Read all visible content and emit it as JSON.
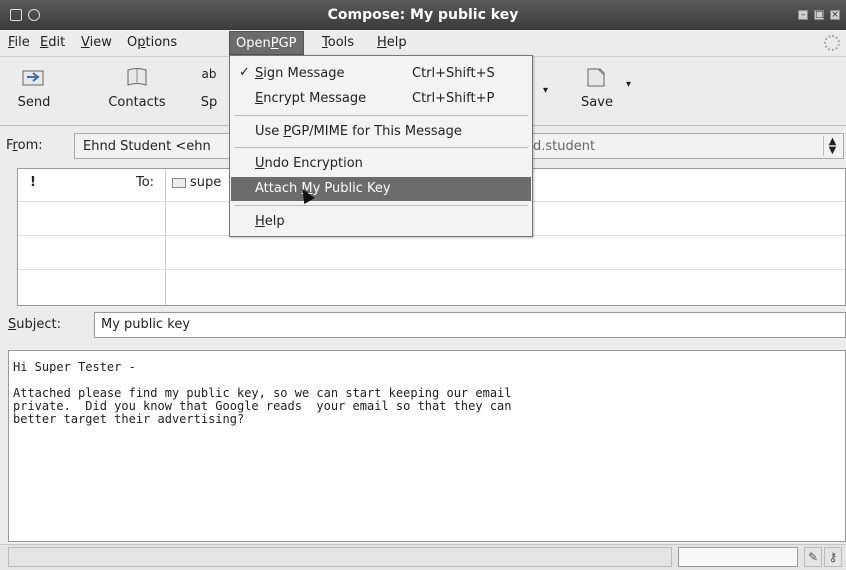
{
  "window": {
    "title": "Compose: My public key"
  },
  "menubar": {
    "items": [
      {
        "label_u": "F",
        "label_rest": "ile"
      },
      {
        "label_u": "E",
        "label_rest": "dit"
      },
      {
        "label_u": "V",
        "label_rest": "iew"
      },
      {
        "label_pre": "O",
        "label_u": "p",
        "label_rest": "tions"
      },
      {
        "label_pre": "Open",
        "label_u": "P",
        "label_rest": "GP"
      },
      {
        "label_u": "T",
        "label_rest": "ools"
      },
      {
        "label_u": "H",
        "label_rest": "elp"
      }
    ]
  },
  "toolbar": {
    "send_label": "Send",
    "contacts_label": "Contacts",
    "spell_top": "ab",
    "spell_label": "Sp",
    "save_label": "Save"
  },
  "from": {
    "label_pre": "F",
    "label_u": "r",
    "label_rest": "om:",
    "value": "Ehnd Student <ehn",
    "value_tail": "d.student"
  },
  "recipients": {
    "to_label": "To:",
    "to_value": "supe"
  },
  "subject": {
    "label_u": "S",
    "label_rest": "ubject:",
    "value": "My public key"
  },
  "body": {
    "greeting": "Hi Super Tester -",
    "lines": [
      "Attached please find my public key, so we can start keeping our email",
      "private.  Did you know that Google reads  your email so that they can",
      "better target their advertising?"
    ]
  },
  "openpgp_menu": {
    "sign_u": "S",
    "sign_rest": "ign Message",
    "sign_shortcut": "Ctrl+Shift+S",
    "encrypt_u": "E",
    "encrypt_rest": "ncrypt Message",
    "encrypt_shortcut": "Ctrl+Shift+P",
    "pgpmime_pre": "Use ",
    "pgpmime_u": "P",
    "pgpmime_rest": "GP/MIME for This Message",
    "undo_u": "U",
    "undo_rest": "ndo Encryption",
    "attach_pre": "Attach ",
    "attach_u": "M",
    "attach_rest": "y Public Key",
    "help_u": "H",
    "help_rest": "elp"
  }
}
